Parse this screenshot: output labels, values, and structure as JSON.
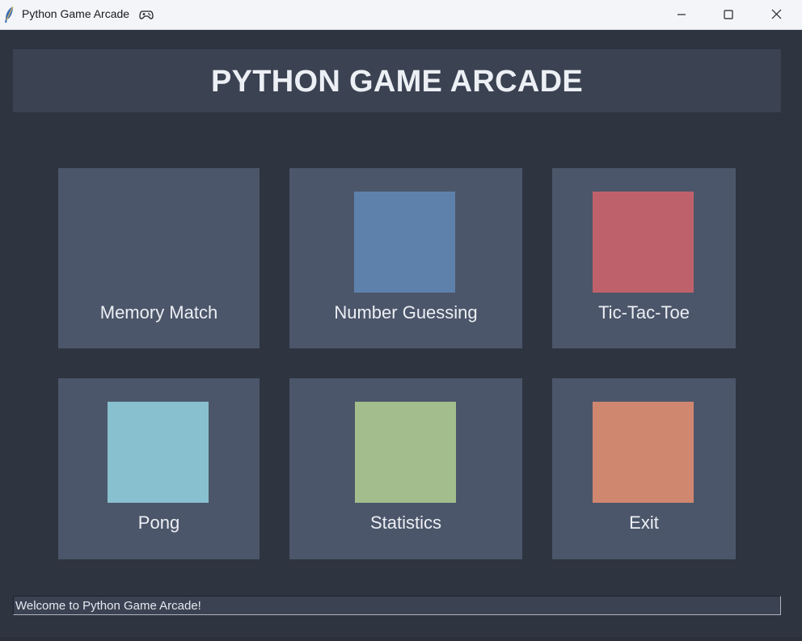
{
  "window": {
    "title": "Python Game Arcade",
    "icon": "feather-icon",
    "title_emoji_icon": "gamepad-icon",
    "controls": [
      "minimize-icon",
      "maximize-icon",
      "close-icon"
    ]
  },
  "header": {
    "title": "PYTHON GAME ARCADE"
  },
  "games": [
    {
      "label": "Memory Match",
      "color": "#4c566a"
    },
    {
      "label": "Number Guessing",
      "color": "#5e81ac"
    },
    {
      "label": "Tic-Tac-Toe",
      "color": "#bf616a"
    },
    {
      "label": "Pong",
      "color": "#88c0d0"
    },
    {
      "label": "Statistics",
      "color": "#a3be8c"
    },
    {
      "label": "Exit",
      "color": "#d08770"
    }
  ],
  "status": {
    "text": "Welcome to Python Game Arcade!"
  },
  "colors": {
    "background": "#2e3440",
    "panel": "#3b4252",
    "tile": "#4c566a",
    "text": "#eceff4"
  }
}
